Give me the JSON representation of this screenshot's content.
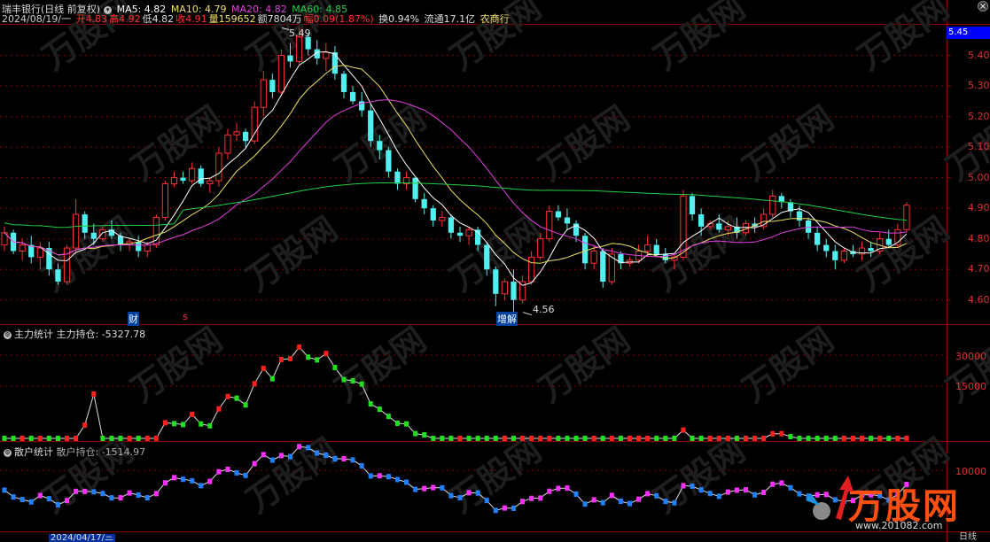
{
  "header": {
    "stock_name": "瑞丰银行(日线 前复权)",
    "ma5": "MA5: 4.82",
    "ma10": "MA10: 4.79",
    "ma20": "MA20: 4.82",
    "ma60": "MA60: 4.85",
    "date": "2024/08/19/一",
    "open": "开4.83",
    "high": "高4.92",
    "low": "低4.82",
    "close": "收4.91",
    "volume": "量159652",
    "amount": "额7804万",
    "change": "幅0.09(1.87%)",
    "turnover": "换0.94%",
    "float": "流通17.1亿",
    "sector": "农商行"
  },
  "price_axis": {
    "labels": [
      "5.40",
      "5.30",
      "5.20",
      "5.10",
      "5.00",
      "4.90",
      "4.80",
      "4.70",
      "4.60"
    ],
    "current_price": "5.45"
  },
  "annotations": {
    "high_marker": "5.49",
    "low_marker": "4.56",
    "caibao_mark": "财",
    "s_mark": "s",
    "zengjian_mark": "增解"
  },
  "panel2": {
    "title": "主力统计",
    "label": "主力持仓: -5327.78",
    "ylabels": [
      "30000",
      "15000"
    ]
  },
  "panel3": {
    "title": "散户统计",
    "label": "散户持仓: -1514.97",
    "ylabels": [
      "10000"
    ]
  },
  "bottom": {
    "date_label": "2024/04/17/三",
    "right_label": "日线"
  },
  "watermark": {
    "brand": "万股网",
    "url": "www.201082.com"
  },
  "colors": {
    "up": "#ff3030",
    "down": "#50f0f0",
    "ma5": "#ffffff",
    "ma10": "#f0e060",
    "ma20": "#e040e0",
    "ma60": "#20d040",
    "grid": "#880000"
  },
  "chart_data": {
    "type": "candlestick",
    "ylim": [
      4.55,
      5.5
    ],
    "candles": [
      [
        4.78,
        4.84,
        4.76,
        4.82
      ],
      [
        4.82,
        4.83,
        4.75,
        4.76
      ],
      [
        4.76,
        4.8,
        4.73,
        4.78
      ],
      [
        4.78,
        4.81,
        4.72,
        4.74
      ],
      [
        4.74,
        4.79,
        4.7,
        4.77
      ],
      [
        4.77,
        4.79,
        4.68,
        4.7
      ],
      [
        4.7,
        4.72,
        4.65,
        4.66
      ],
      [
        4.66,
        4.78,
        4.65,
        4.77
      ],
      [
        4.77,
        4.93,
        4.75,
        4.88
      ],
      [
        4.88,
        4.89,
        4.8,
        4.82
      ],
      [
        4.82,
        4.85,
        4.78,
        4.8
      ],
      [
        4.8,
        4.84,
        4.79,
        4.83
      ],
      [
        4.83,
        4.86,
        4.8,
        4.81
      ],
      [
        4.81,
        4.82,
        4.76,
        4.78
      ],
      [
        4.78,
        4.8,
        4.76,
        4.79
      ],
      [
        4.79,
        4.81,
        4.74,
        4.76
      ],
      [
        4.76,
        4.79,
        4.74,
        4.78
      ],
      [
        4.78,
        4.88,
        4.77,
        4.87
      ],
      [
        4.87,
        4.99,
        4.86,
        4.98
      ],
      [
        4.98,
        5.02,
        4.97,
        5.0
      ],
      [
        5.0,
        5.02,
        4.98,
        4.99
      ],
      [
        4.99,
        5.05,
        4.98,
        5.03
      ],
      [
        5.03,
        5.04,
        4.97,
        4.98
      ],
      [
        4.98,
        5.0,
        4.95,
        4.99
      ],
      [
        4.99,
        5.1,
        4.97,
        5.08
      ],
      [
        5.08,
        5.16,
        5.06,
        5.14
      ],
      [
        5.14,
        5.18,
        5.12,
        5.15
      ],
      [
        5.15,
        5.16,
        5.1,
        5.12
      ],
      [
        5.12,
        5.25,
        5.11,
        5.23
      ],
      [
        5.23,
        5.35,
        5.2,
        5.32
      ],
      [
        5.32,
        5.34,
        5.26,
        5.28
      ],
      [
        5.28,
        5.42,
        5.27,
        5.4
      ],
      [
        5.4,
        5.44,
        5.36,
        5.38
      ],
      [
        5.38,
        5.49,
        5.37,
        5.46
      ],
      [
        5.46,
        5.47,
        5.4,
        5.42
      ],
      [
        5.42,
        5.45,
        5.37,
        5.39
      ],
      [
        5.39,
        5.44,
        5.35,
        5.41
      ],
      [
        5.41,
        5.43,
        5.32,
        5.34
      ],
      [
        5.34,
        5.35,
        5.26,
        5.28
      ],
      [
        5.28,
        5.3,
        5.24,
        5.25
      ],
      [
        5.25,
        5.28,
        5.2,
        5.22
      ],
      [
        5.22,
        5.24,
        5.1,
        5.12
      ],
      [
        5.12,
        5.14,
        5.06,
        5.09
      ],
      [
        5.09,
        5.1,
        5.0,
        5.02
      ],
      [
        5.02,
        5.03,
        4.96,
        4.98
      ],
      [
        4.98,
        5.02,
        4.96,
        5.0
      ],
      [
        5.0,
        5.0,
        4.92,
        4.93
      ],
      [
        4.93,
        4.95,
        4.88,
        4.9
      ],
      [
        4.9,
        4.91,
        4.84,
        4.86
      ],
      [
        4.86,
        4.89,
        4.84,
        4.87
      ],
      [
        4.87,
        4.88,
        4.8,
        4.82
      ],
      [
        4.82,
        4.84,
        4.79,
        4.81
      ],
      [
        4.81,
        4.84,
        4.78,
        4.83
      ],
      [
        4.83,
        4.84,
        4.76,
        4.78
      ],
      [
        4.78,
        4.79,
        4.68,
        4.7
      ],
      [
        4.7,
        4.71,
        4.58,
        4.62
      ],
      [
        4.62,
        4.67,
        4.6,
        4.66
      ],
      [
        4.66,
        4.7,
        4.56,
        4.6
      ],
      [
        4.6,
        4.68,
        4.59,
        4.66
      ],
      [
        4.66,
        4.76,
        4.65,
        4.74
      ],
      [
        4.74,
        4.82,
        4.73,
        4.8
      ],
      [
        4.8,
        4.91,
        4.79,
        4.89
      ],
      [
        4.89,
        4.91,
        4.86,
        4.87
      ],
      [
        4.87,
        4.9,
        4.83,
        4.85
      ],
      [
        4.85,
        4.86,
        4.79,
        4.81
      ],
      [
        4.81,
        4.82,
        4.7,
        4.72
      ],
      [
        4.72,
        4.78,
        4.7,
        4.76
      ],
      [
        4.76,
        4.77,
        4.64,
        4.66
      ],
      [
        4.66,
        4.77,
        4.65,
        4.75
      ],
      [
        4.75,
        4.76,
        4.7,
        4.72
      ],
      [
        4.72,
        4.74,
        4.71,
        4.73
      ],
      [
        4.73,
        4.78,
        4.72,
        4.76
      ],
      [
        4.76,
        4.81,
        4.74,
        4.78
      ],
      [
        4.78,
        4.8,
        4.74,
        4.75
      ],
      [
        4.75,
        4.77,
        4.72,
        4.73
      ],
      [
        4.73,
        4.75,
        4.7,
        4.74
      ],
      [
        4.74,
        4.96,
        4.73,
        4.94
      ],
      [
        4.94,
        4.95,
        4.86,
        4.88
      ],
      [
        4.88,
        4.9,
        4.81,
        4.84
      ],
      [
        4.84,
        4.86,
        4.83,
        4.85
      ],
      [
        4.85,
        4.88,
        4.82,
        4.83
      ],
      [
        4.83,
        4.86,
        4.81,
        4.84
      ],
      [
        4.84,
        4.87,
        4.8,
        4.82
      ],
      [
        4.82,
        4.86,
        4.81,
        4.85
      ],
      [
        4.85,
        4.87,
        4.82,
        4.84
      ],
      [
        4.84,
        4.9,
        4.83,
        4.88
      ],
      [
        4.88,
        4.96,
        4.87,
        4.94
      ],
      [
        4.94,
        4.95,
        4.9,
        4.92
      ],
      [
        4.92,
        4.93,
        4.87,
        4.89
      ],
      [
        4.89,
        4.91,
        4.84,
        4.86
      ],
      [
        4.86,
        4.87,
        4.8,
        4.82
      ],
      [
        4.82,
        4.84,
        4.76,
        4.78
      ],
      [
        4.78,
        4.8,
        4.74,
        4.76
      ],
      [
        4.76,
        4.78,
        4.7,
        4.73
      ],
      [
        4.73,
        4.77,
        4.72,
        4.76
      ],
      [
        4.76,
        4.78,
        4.74,
        4.75
      ],
      [
        4.75,
        4.79,
        4.73,
        4.77
      ],
      [
        4.77,
        4.79,
        4.74,
        4.76
      ],
      [
        4.76,
        4.82,
        4.75,
        4.8
      ],
      [
        4.8,
        4.83,
        4.77,
        4.78
      ],
      [
        4.78,
        4.85,
        4.77,
        4.83
      ],
      [
        4.83,
        4.92,
        4.82,
        4.91
      ]
    ]
  }
}
